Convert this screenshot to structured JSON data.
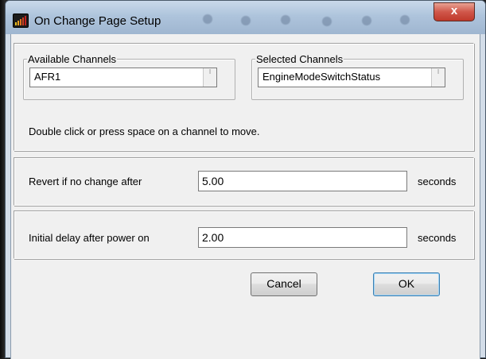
{
  "window": {
    "title": "On Change Page Setup",
    "close_glyph": "x",
    "icon": "bar-chart-app-icon"
  },
  "channels": {
    "available_label": "Available Channels",
    "available_value": "AFR1",
    "selected_label": "Selected Channels",
    "selected_value": "EngineModeSwitchStatus",
    "spinner_glyph": "⁝",
    "hint": "Double click or press space on a channel to move."
  },
  "revert": {
    "label": "Revert if no change after",
    "value": "5.00",
    "unit": "seconds"
  },
  "initial_delay": {
    "label": "Initial delay after power on",
    "value": "2.00",
    "unit": "seconds"
  },
  "buttons": {
    "cancel": "Cancel",
    "ok": "OK"
  },
  "colors": {
    "close_button": "#c0392b",
    "default_button_border": "#3c7fb1"
  }
}
